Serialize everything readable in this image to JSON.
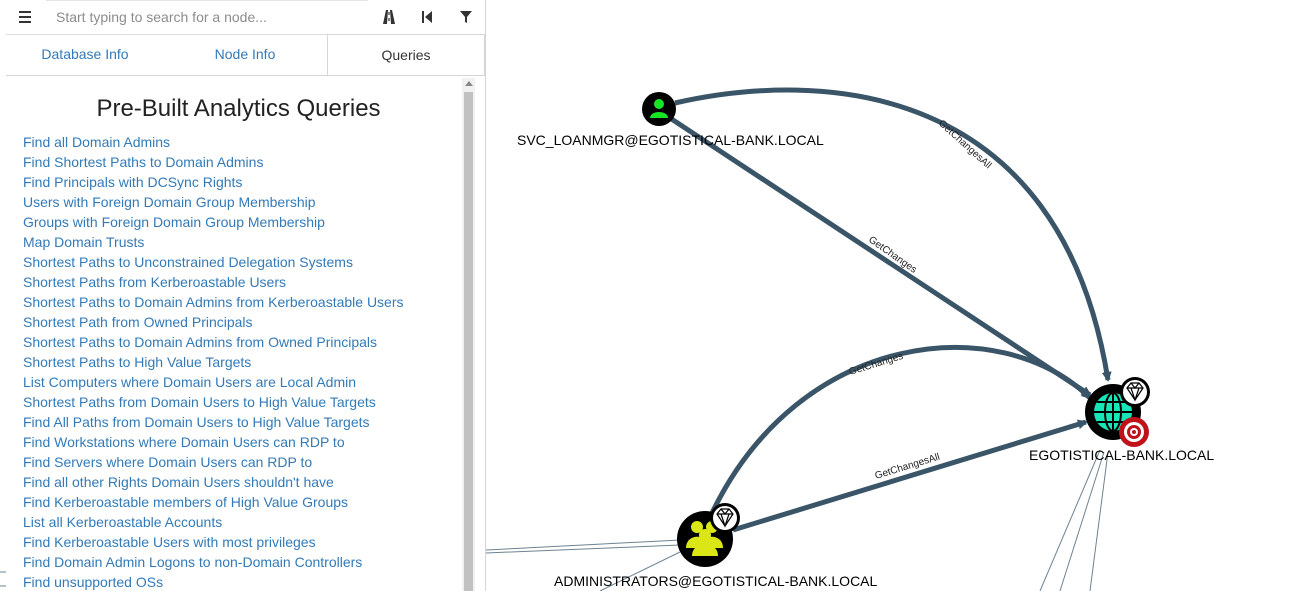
{
  "search": {
    "placeholder": "Start typing to search for a node..."
  },
  "toolbar": {
    "menu_icon": "hamburger-menu-icon",
    "pathfinding_icon": "road-icon",
    "back_icon": "skip-back-icon",
    "filter_icon": "filter-icon"
  },
  "tabs": [
    {
      "label": "Database Info",
      "active": false
    },
    {
      "label": "Node Info",
      "active": false
    },
    {
      "label": "Queries",
      "active": true
    }
  ],
  "queries": {
    "title": "Pre-Built Analytics Queries",
    "items": [
      "Find all Domain Admins",
      "Find Shortest Paths to Domain Admins",
      "Find Principals with DCSync Rights",
      "Users with Foreign Domain Group Membership",
      "Groups with Foreign Domain Group Membership",
      "Map Domain Trusts",
      "Shortest Paths to Unconstrained Delegation Systems",
      "Shortest Paths from Kerberoastable Users",
      "Shortest Paths to Domain Admins from Kerberoastable Users",
      "Shortest Path from Owned Principals",
      "Shortest Paths to Domain Admins from Owned Principals",
      "Shortest Paths to High Value Targets",
      "List Computers where Domain Users are Local Admin",
      "Shortest Paths from Domain Users to High Value Targets",
      "Find All Paths from Domain Users to High Value Targets",
      "Find Workstations where Domain Users can RDP to",
      "Find Servers where Domain Users can RDP to",
      "Find all other Rights Domain Users shouldn't have",
      "Find Kerberoastable members of High Value Groups",
      "List all Kerberoastable Accounts",
      "Find Kerberoastable Users with most privileges",
      "Find Domain Admin Logons to non-Domain Controllers",
      "Find unsupported OSs"
    ]
  },
  "graph": {
    "nodes": {
      "user": {
        "label": "SVC_LOANMGR@EGOTISTICAL-BANK.LOCAL",
        "icon": "user-icon",
        "color": "#17e625"
      },
      "domain": {
        "label": "EGOTISTICAL-BANK.LOCAL",
        "icon": "globe-icon",
        "color": "#17e6b9",
        "badges": [
          "diamond-icon",
          "target-icon"
        ]
      },
      "group": {
        "label": "ADMINISTRATORS@EGOTISTICAL-BANK.LOCAL",
        "icon": "group-icon",
        "color": "#dbe617",
        "badges": [
          "diamond-icon"
        ]
      }
    },
    "edges": {
      "e1": "GetChangesAll",
      "e2": "GetChanges",
      "e3": "GetChanges",
      "e4": "GetChangesAll"
    },
    "edge_color": "#3a5568"
  }
}
